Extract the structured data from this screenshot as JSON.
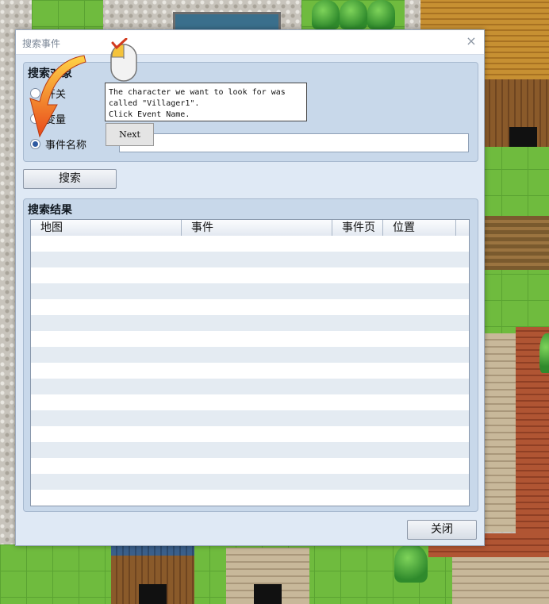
{
  "dialog": {
    "title": "搜索事件",
    "close_glyph": "×",
    "search_target": {
      "title": "搜索对象",
      "options": [
        {
          "label": "开关",
          "checked": false
        },
        {
          "label": "变量",
          "checked": false
        },
        {
          "label": "事件名称",
          "checked": true
        }
      ],
      "event_name_value": ""
    },
    "search_button": "搜索",
    "results": {
      "title": "搜索结果",
      "columns": [
        "地图",
        "事件",
        "事件页",
        "位置"
      ],
      "rows": []
    },
    "close_button": "关闭"
  },
  "tutorial": {
    "tooltip_lines": [
      "The character we want to look for was",
      "called \"Villager1\".",
      "Click Event Name."
    ],
    "next_button": "Next",
    "icons": [
      "mouse-click-icon",
      "pointer-arrow-icon"
    ]
  },
  "colors": {
    "dialog_bg": "#dfe9f5",
    "group_bg": "#c8d8ea",
    "row_alt": "#e4ebf2",
    "arrow": "#e8611e",
    "grass": "#6fbb3e"
  }
}
